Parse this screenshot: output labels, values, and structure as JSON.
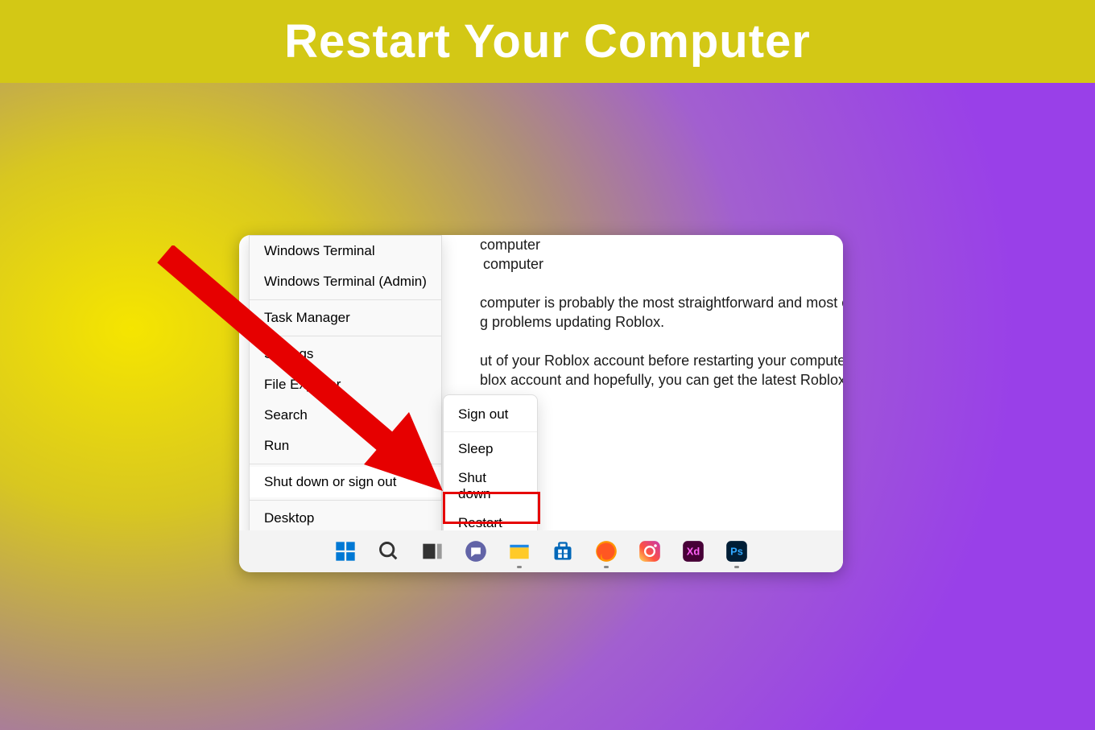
{
  "title": "Restart Your Computer",
  "background_text": {
    "line1": "computer",
    "line2_partial": "computer",
    "line3": "computer is probably the most straightforward and most comm",
    "line4": "g problems updating Roblox.",
    "line5": "ut of your Roblox account before restarting your computer. Onc",
    "line6": "blox account and hopefully, you can get the latest Roblox versio"
  },
  "context_menu": {
    "items": [
      {
        "label": "Windows Terminal"
      },
      {
        "label": "Windows Terminal (Admin)"
      },
      {
        "label": "Task Manager"
      },
      {
        "label": "Settings"
      },
      {
        "label": "File Explorer"
      },
      {
        "label": "Search"
      },
      {
        "label": "Run"
      },
      {
        "label": "Shut down or sign out"
      },
      {
        "label": "Desktop"
      }
    ]
  },
  "submenu": {
    "items": [
      {
        "label": "Sign out"
      },
      {
        "label": "Sleep"
      },
      {
        "label": "Shut down"
      },
      {
        "label": "Restart"
      }
    ]
  },
  "taskbar_icons": [
    "start",
    "search",
    "task-view",
    "chat",
    "file-explorer",
    "microsoft-store",
    "firefox",
    "instagram",
    "adobe-xd",
    "photoshop"
  ]
}
